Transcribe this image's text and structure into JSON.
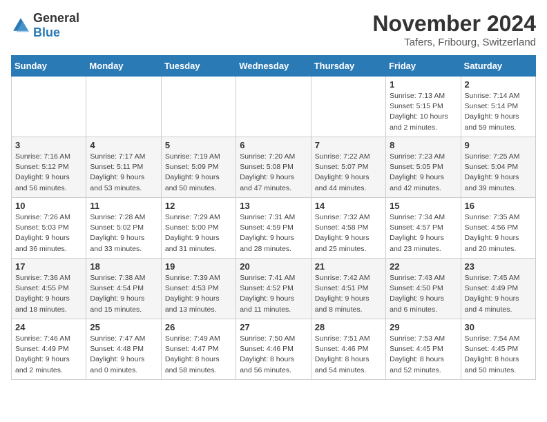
{
  "logo": {
    "text_general": "General",
    "text_blue": "Blue"
  },
  "header": {
    "month_year": "November 2024",
    "location": "Tafers, Fribourg, Switzerland"
  },
  "days_of_week": [
    "Sunday",
    "Monday",
    "Tuesday",
    "Wednesday",
    "Thursday",
    "Friday",
    "Saturday"
  ],
  "weeks": [
    [
      {
        "day": "",
        "detail": ""
      },
      {
        "day": "",
        "detail": ""
      },
      {
        "day": "",
        "detail": ""
      },
      {
        "day": "",
        "detail": ""
      },
      {
        "day": "",
        "detail": ""
      },
      {
        "day": "1",
        "detail": "Sunrise: 7:13 AM\nSunset: 5:15 PM\nDaylight: 10 hours\nand 2 minutes."
      },
      {
        "day": "2",
        "detail": "Sunrise: 7:14 AM\nSunset: 5:14 PM\nDaylight: 9 hours\nand 59 minutes."
      }
    ],
    [
      {
        "day": "3",
        "detail": "Sunrise: 7:16 AM\nSunset: 5:12 PM\nDaylight: 9 hours\nand 56 minutes."
      },
      {
        "day": "4",
        "detail": "Sunrise: 7:17 AM\nSunset: 5:11 PM\nDaylight: 9 hours\nand 53 minutes."
      },
      {
        "day": "5",
        "detail": "Sunrise: 7:19 AM\nSunset: 5:09 PM\nDaylight: 9 hours\nand 50 minutes."
      },
      {
        "day": "6",
        "detail": "Sunrise: 7:20 AM\nSunset: 5:08 PM\nDaylight: 9 hours\nand 47 minutes."
      },
      {
        "day": "7",
        "detail": "Sunrise: 7:22 AM\nSunset: 5:07 PM\nDaylight: 9 hours\nand 44 minutes."
      },
      {
        "day": "8",
        "detail": "Sunrise: 7:23 AM\nSunset: 5:05 PM\nDaylight: 9 hours\nand 42 minutes."
      },
      {
        "day": "9",
        "detail": "Sunrise: 7:25 AM\nSunset: 5:04 PM\nDaylight: 9 hours\nand 39 minutes."
      }
    ],
    [
      {
        "day": "10",
        "detail": "Sunrise: 7:26 AM\nSunset: 5:03 PM\nDaylight: 9 hours\nand 36 minutes."
      },
      {
        "day": "11",
        "detail": "Sunrise: 7:28 AM\nSunset: 5:02 PM\nDaylight: 9 hours\nand 33 minutes."
      },
      {
        "day": "12",
        "detail": "Sunrise: 7:29 AM\nSunset: 5:00 PM\nDaylight: 9 hours\nand 31 minutes."
      },
      {
        "day": "13",
        "detail": "Sunrise: 7:31 AM\nSunset: 4:59 PM\nDaylight: 9 hours\nand 28 minutes."
      },
      {
        "day": "14",
        "detail": "Sunrise: 7:32 AM\nSunset: 4:58 PM\nDaylight: 9 hours\nand 25 minutes."
      },
      {
        "day": "15",
        "detail": "Sunrise: 7:34 AM\nSunset: 4:57 PM\nDaylight: 9 hours\nand 23 minutes."
      },
      {
        "day": "16",
        "detail": "Sunrise: 7:35 AM\nSunset: 4:56 PM\nDaylight: 9 hours\nand 20 minutes."
      }
    ],
    [
      {
        "day": "17",
        "detail": "Sunrise: 7:36 AM\nSunset: 4:55 PM\nDaylight: 9 hours\nand 18 minutes."
      },
      {
        "day": "18",
        "detail": "Sunrise: 7:38 AM\nSunset: 4:54 PM\nDaylight: 9 hours\nand 15 minutes."
      },
      {
        "day": "19",
        "detail": "Sunrise: 7:39 AM\nSunset: 4:53 PM\nDaylight: 9 hours\nand 13 minutes."
      },
      {
        "day": "20",
        "detail": "Sunrise: 7:41 AM\nSunset: 4:52 PM\nDaylight: 9 hours\nand 11 minutes."
      },
      {
        "day": "21",
        "detail": "Sunrise: 7:42 AM\nSunset: 4:51 PM\nDaylight: 9 hours\nand 8 minutes."
      },
      {
        "day": "22",
        "detail": "Sunrise: 7:43 AM\nSunset: 4:50 PM\nDaylight: 9 hours\nand 6 minutes."
      },
      {
        "day": "23",
        "detail": "Sunrise: 7:45 AM\nSunset: 4:49 PM\nDaylight: 9 hours\nand 4 minutes."
      }
    ],
    [
      {
        "day": "24",
        "detail": "Sunrise: 7:46 AM\nSunset: 4:49 PM\nDaylight: 9 hours\nand 2 minutes."
      },
      {
        "day": "25",
        "detail": "Sunrise: 7:47 AM\nSunset: 4:48 PM\nDaylight: 9 hours\nand 0 minutes."
      },
      {
        "day": "26",
        "detail": "Sunrise: 7:49 AM\nSunset: 4:47 PM\nDaylight: 8 hours\nand 58 minutes."
      },
      {
        "day": "27",
        "detail": "Sunrise: 7:50 AM\nSunset: 4:46 PM\nDaylight: 8 hours\nand 56 minutes."
      },
      {
        "day": "28",
        "detail": "Sunrise: 7:51 AM\nSunset: 4:46 PM\nDaylight: 8 hours\nand 54 minutes."
      },
      {
        "day": "29",
        "detail": "Sunrise: 7:53 AM\nSunset: 4:45 PM\nDaylight: 8 hours\nand 52 minutes."
      },
      {
        "day": "30",
        "detail": "Sunrise: 7:54 AM\nSunset: 4:45 PM\nDaylight: 8 hours\nand 50 minutes."
      }
    ]
  ]
}
